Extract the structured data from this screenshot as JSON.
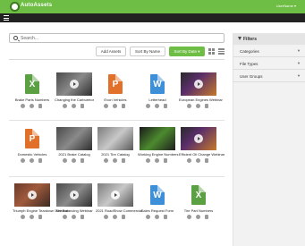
{
  "header": {
    "logo_text": "AutoAssets",
    "user_menu": "UserName ▾"
  },
  "search": {
    "placeholder": "Search..."
  },
  "toolbar": {
    "add_assets": "Add Assets",
    "sort_by_name": "Sort By Name",
    "sort_by_date": "Sort By Date ▾"
  },
  "filters": {
    "title": "Filters",
    "items": [
      {
        "label": "Categories"
      },
      {
        "label": "File Types"
      },
      {
        "label": "User Groups"
      }
    ]
  },
  "colors": {
    "brand": "#6ebd44",
    "excel": "#5ba043",
    "powerpoint": "#e1702b",
    "word": "#3d8fd8"
  },
  "assets": [
    {
      "title": "Brake Parts Numbers",
      "kind": "excel"
    },
    {
      "title": "Changing the Carburetor",
      "kind": "video"
    },
    {
      "title": "Evon Vehicles",
      "kind": "powerpoint"
    },
    {
      "title": "Letterhead",
      "kind": "word"
    },
    {
      "title": "European Engines Webinar",
      "kind": "video"
    },
    {
      "title": "Domestic Vehicles",
      "kind": "powerpoint"
    },
    {
      "title": "2021 Brake Catalog",
      "kind": "image"
    },
    {
      "title": "2021 Tire Catalog",
      "kind": "image"
    },
    {
      "title": "Working Engine Numbers",
      "kind": "image"
    },
    {
      "title": "Efficient Oil Change Webinar",
      "kind": "video"
    },
    {
      "title": "Triumph Engine Teardown Webinar",
      "kind": "video"
    },
    {
      "title": "Tire Balancing Webinar",
      "kind": "video"
    },
    {
      "title": "2021 RoadShow Commercial",
      "kind": "video"
    },
    {
      "title": "Sales Request Form",
      "kind": "word"
    },
    {
      "title": "Tire Part Numbers",
      "kind": "excel"
    }
  ]
}
